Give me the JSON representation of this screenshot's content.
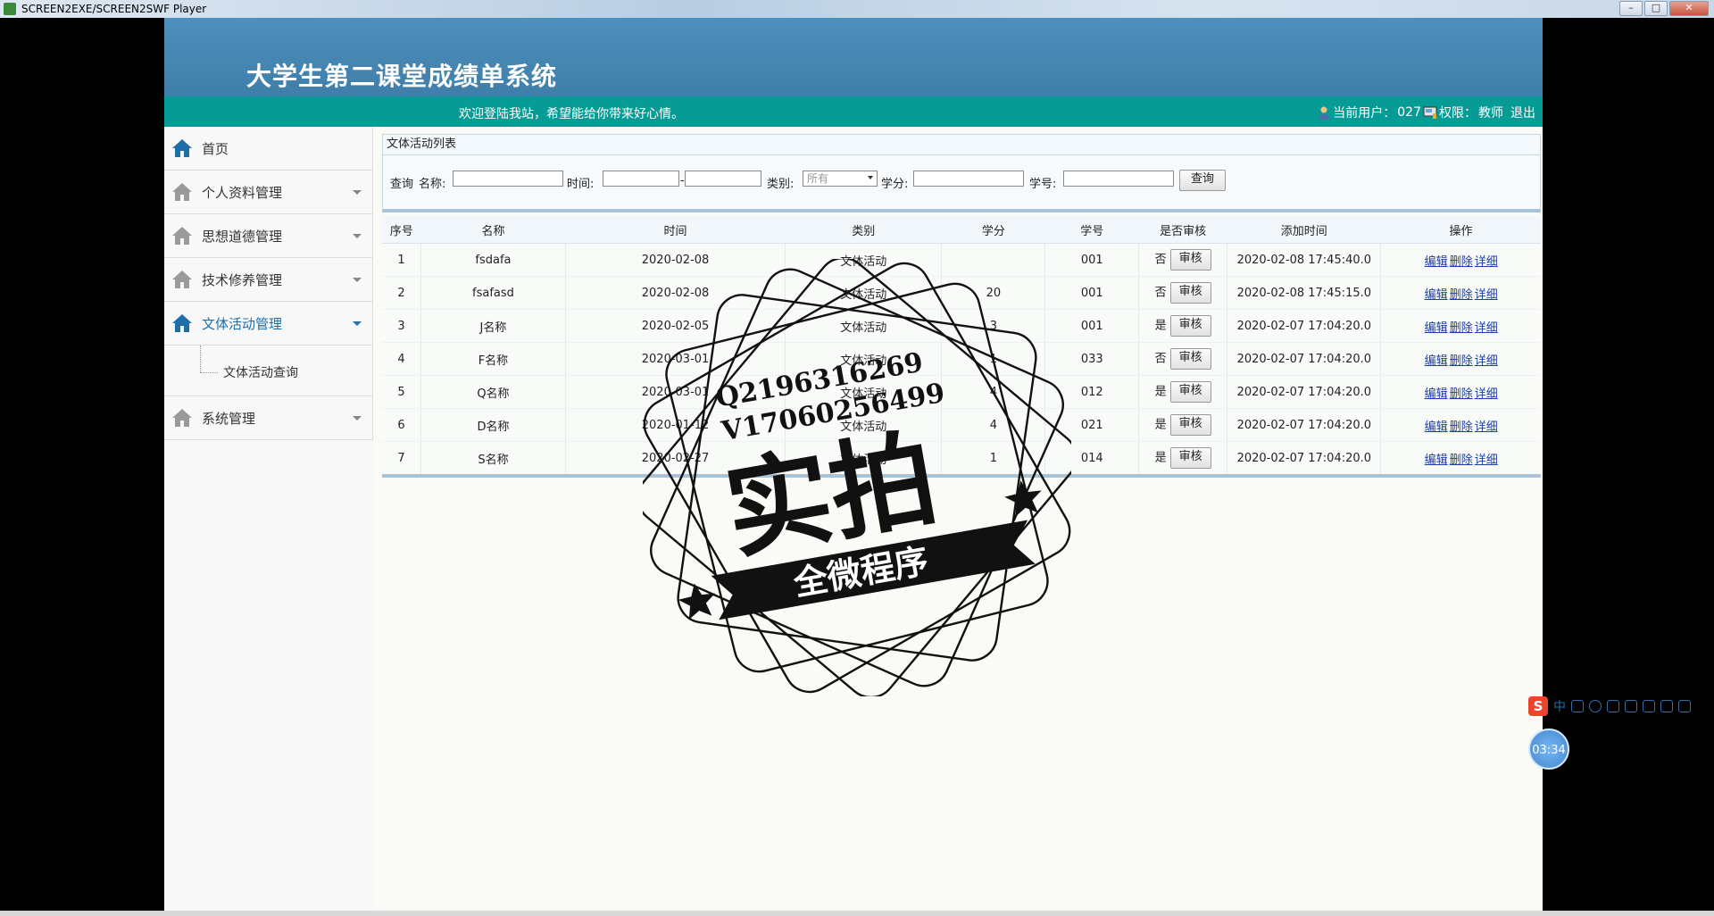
{
  "window": {
    "title": "SCREEN2EXE/SCREEN2SWF Player"
  },
  "header": {
    "title": "大学生第二课堂成绩单系统"
  },
  "welcome": {
    "message": "欢迎登陆我站，希望能给你带来好心情。",
    "current_user_label": "当前用户：",
    "current_user": "027",
    "role_label": "权限：",
    "role": "教师",
    "logout": "退出"
  },
  "sidebar": {
    "items": [
      {
        "label": "首页"
      },
      {
        "label": "个人资料管理"
      },
      {
        "label": "思想道德管理"
      },
      {
        "label": "技术修养管理"
      },
      {
        "label": "文体活动管理",
        "active": true,
        "children": [
          {
            "label": "文体活动查询"
          }
        ]
      },
      {
        "label": "系统管理"
      }
    ]
  },
  "panel": {
    "title": "文体活动列表"
  },
  "search": {
    "query_label": "查询",
    "name_label": "名称:",
    "time_label": "时间:",
    "range_sep": "-",
    "type_label": "类别:",
    "type_selected": "所有",
    "credit_label": "学分:",
    "student_no_label": "学号:",
    "button": "查询"
  },
  "table": {
    "headers": [
      "序号",
      "名称",
      "时间",
      "类别",
      "学分",
      "学号",
      "是否审核",
      "添加时间",
      "操作"
    ],
    "audit_button": "审核",
    "actions": [
      "编辑",
      "删除",
      "详细"
    ],
    "rows": [
      {
        "no": "1",
        "name": "fsdafa",
        "time": "2020-02-08",
        "type": "文体活动",
        "credit": "",
        "sid": "001",
        "audited": "否",
        "added": "2020-02-08 17:45:40.0"
      },
      {
        "no": "2",
        "name": "fsafasd",
        "time": "2020-02-08",
        "type": "文体活动",
        "credit": "20",
        "sid": "001",
        "audited": "否",
        "added": "2020-02-08 17:45:15.0"
      },
      {
        "no": "3",
        "name": "J名称",
        "time": "2020-02-05",
        "type": "文体活动",
        "credit": "3",
        "sid": "001",
        "audited": "是",
        "added": "2020-02-07 17:04:20.0"
      },
      {
        "no": "4",
        "name": "F名称",
        "time": "2020-03-01",
        "type": "文体活动",
        "credit": "1",
        "sid": "033",
        "audited": "否",
        "added": "2020-02-07 17:04:20.0"
      },
      {
        "no": "5",
        "name": "Q名称",
        "time": "2020-03-01",
        "type": "文体活动",
        "credit": "4",
        "sid": "012",
        "audited": "是",
        "added": "2020-02-07 17:04:20.0"
      },
      {
        "no": "6",
        "name": "D名称",
        "time": "2020-01-12",
        "type": "文体活动",
        "credit": "4",
        "sid": "021",
        "audited": "是",
        "added": "2020-02-07 17:04:20.0"
      },
      {
        "no": "7",
        "name": "S名称",
        "time": "2020-02-27",
        "type": "文体活动",
        "credit": "1",
        "sid": "014",
        "audited": "是",
        "added": "2020-02-07 17:04:20.0"
      }
    ]
  },
  "watermark": {
    "line1": "Q2196316269",
    "line2": "V17060256499",
    "big": "实拍",
    "ribbon": "全微程序"
  },
  "ime": {
    "logo": "S",
    "mode": "中"
  },
  "recorder": {
    "timer": "03:34"
  },
  "colors": {
    "header": "#3f7ea9",
    "welcome_bar": "#069c95",
    "active_menu": "#1f6ea8",
    "link": "#1b3ea8"
  }
}
